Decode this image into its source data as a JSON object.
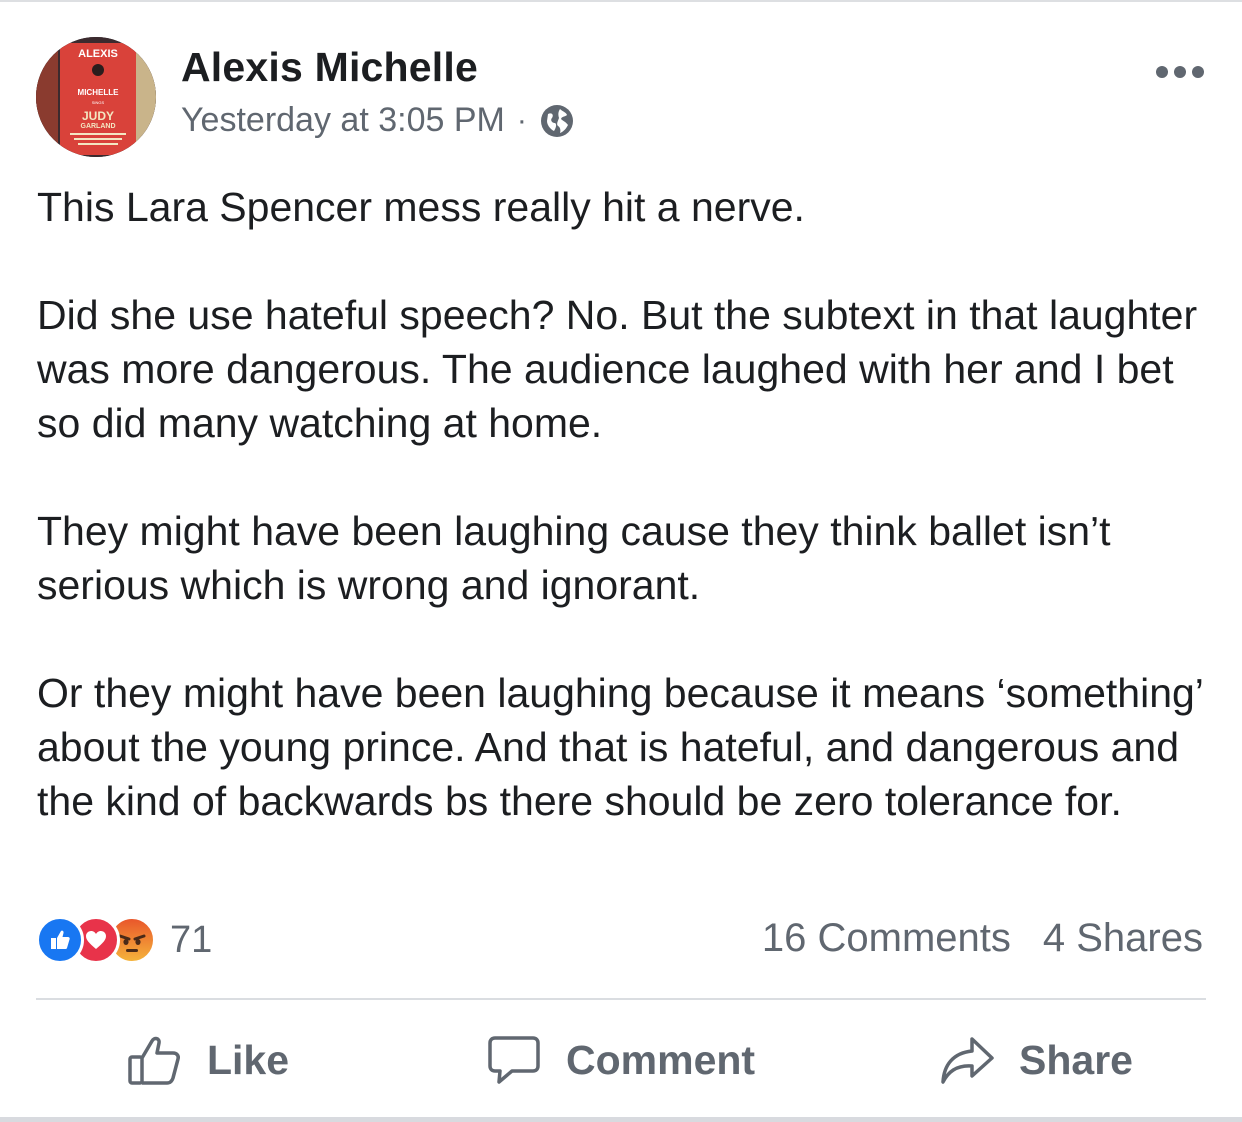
{
  "post": {
    "author": "Alexis Michelle",
    "timestamp": "Yesterday at 3:05 PM",
    "separator": "·",
    "privacy_icon": "globe-icon",
    "avatar_text": {
      "top": "ALEXIS",
      "middle": "MICHELLE",
      "sings": "SINGS",
      "judy": "JUDY",
      "garland": "GARLAND"
    },
    "paragraphs": [
      "This Lara Spencer mess really hit a nerve.",
      "Did she use hateful speech? No. But the subtext in that laughter was more dangerous. The audience laughed with her and I bet so did many watching at home.",
      "They might have been laughing cause they think ballet isn’t serious which is wrong and ignorant.",
      "Or they might have been laughing because it means ‘something’ about the young prince. And that is hateful, and dangerous and the kind of backwards bs there should be zero tolerance for."
    ]
  },
  "reactions": {
    "icons": [
      "like-reaction-icon",
      "love-reaction-icon",
      "angry-reaction-icon"
    ],
    "count": "71",
    "comments": "16 Comments",
    "shares": "4 Shares"
  },
  "actions": {
    "like": "Like",
    "comment": "Comment",
    "share": "Share"
  },
  "colors": {
    "text": "#1c1e21",
    "secondary_text": "#606770",
    "like_blue": "#1877f2",
    "love_red": "#e8334a",
    "angry_orange": "#f5b33b"
  }
}
